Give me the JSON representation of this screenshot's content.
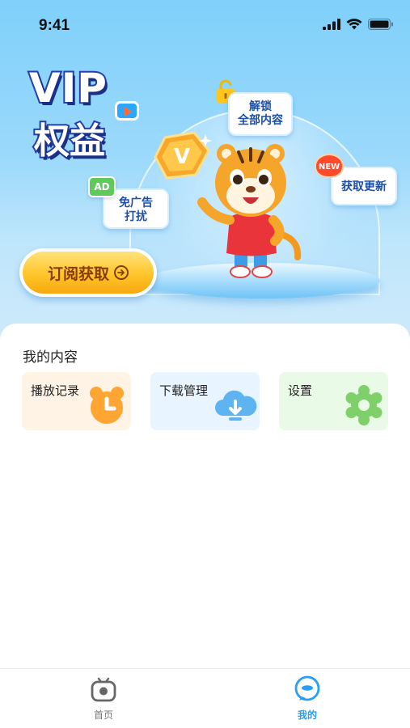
{
  "status_bar": {
    "time": "9:41"
  },
  "hero": {
    "vip_title": "VIP",
    "vip_subtitle": "权益",
    "features": {
      "unlock": [
        "解锁",
        "全部内容"
      ],
      "update": "获取更新",
      "no_ads": [
        "免广告",
        "打扰"
      ],
      "new_badge": "NEW",
      "ad_badge": "AD"
    },
    "v_badge": "V",
    "subscribe_button": "订阅获取"
  },
  "my_content": {
    "title": "我的内容",
    "tiles": [
      {
        "label": "播放记录",
        "icon": "alarm-clock-icon",
        "color": "#ffa534"
      },
      {
        "label": "下载管理",
        "icon": "cloud-download-icon",
        "color": "#5db4f0"
      },
      {
        "label": "设置",
        "icon": "gear-icon",
        "color": "#7fd06a"
      }
    ]
  },
  "tab_bar": {
    "tabs": [
      {
        "label": "首页",
        "icon": "tv-icon",
        "active": false
      },
      {
        "label": "我的",
        "icon": "chat-bubble-icon",
        "active": true
      }
    ]
  },
  "colors": {
    "accent": "#2a9df4",
    "button": "#ffc52a",
    "hero_bg": "#8fd4fb"
  }
}
